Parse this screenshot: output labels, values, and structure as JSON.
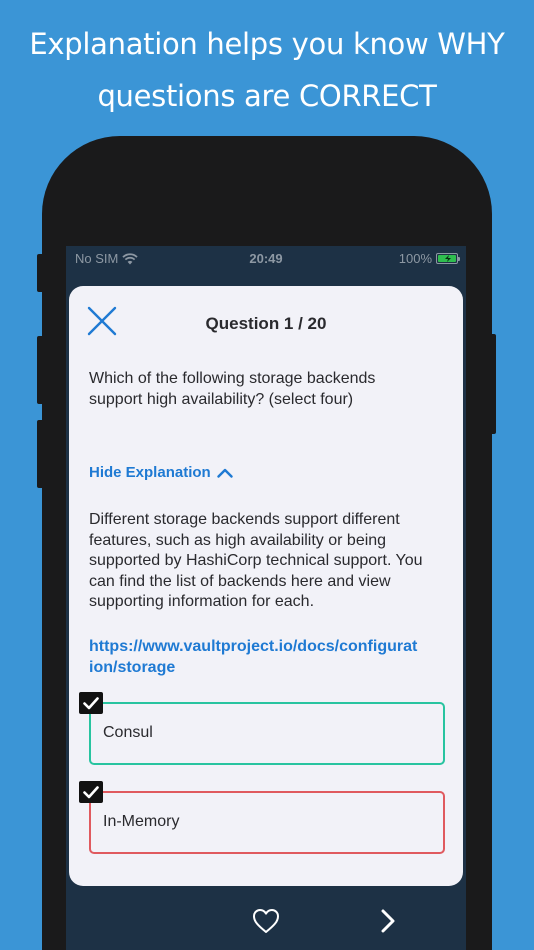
{
  "promo": {
    "line1": "Explanation helps you know WHY",
    "line2": "questions are CORRECT"
  },
  "statusbar": {
    "carrier": "No SIM",
    "time": "20:49",
    "battery": "100%"
  },
  "quiz": {
    "title": "Question 1 / 20",
    "question": "Which of the following storage backends support high availability? (select four)",
    "toggle_label": "Hide Explanation",
    "explanation": "Different storage backends support different features, such as high availability or being supported by HashiCorp technical support. You can find the list of backends here and view supporting information for each.",
    "link": "https://www.vaultproject.io/docs/configuration/storage",
    "options": [
      {
        "label": "Consul",
        "checked": true,
        "state": "correct"
      },
      {
        "label": "In-Memory",
        "checked": true,
        "state": "incorrect"
      }
    ]
  },
  "colors": {
    "background": "#3b95d6",
    "accent": "#1f7ad3",
    "correct": "#28c4a0",
    "incorrect": "#e05a5f",
    "screen": "#1d3145"
  },
  "icons": {
    "close": "close-icon",
    "toggle": "chevron-up-icon",
    "check": "check-icon",
    "favorite": "heart-icon",
    "next": "chevron-right-icon",
    "wifi": "wifi-icon",
    "battery": "battery-icon"
  }
}
